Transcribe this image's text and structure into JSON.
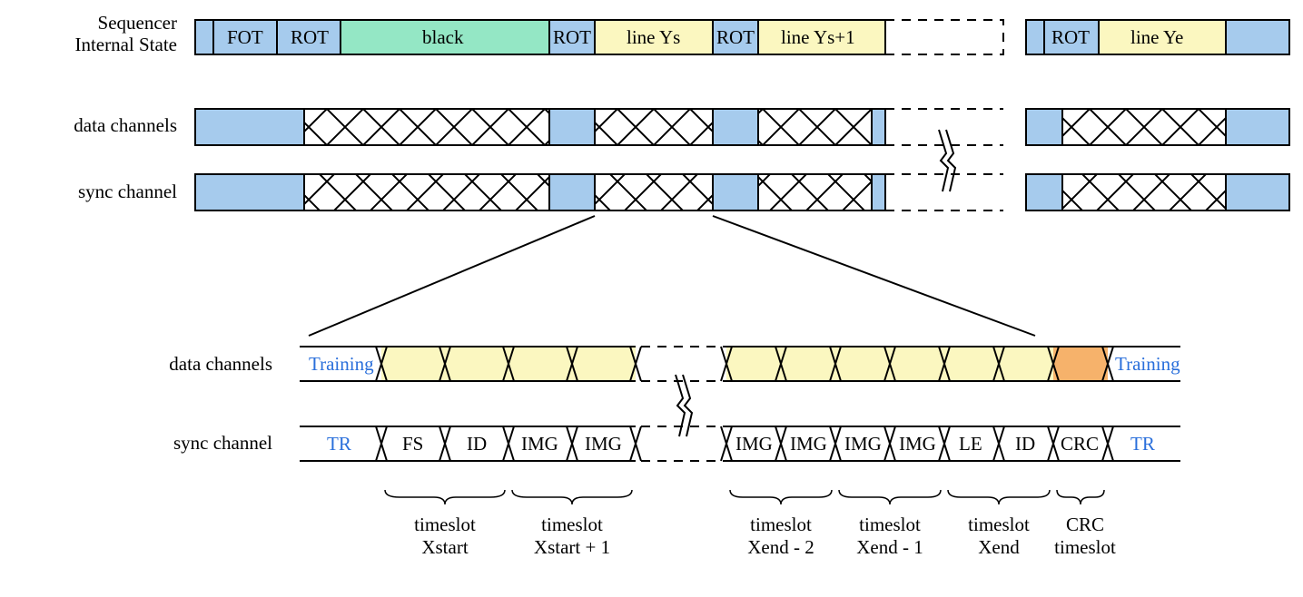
{
  "rows": {
    "seq1": "Sequencer",
    "seq2": "Internal State",
    "data": "data channels",
    "sync": "sync channel"
  },
  "top_states": {
    "fot": "FOT",
    "rot": "ROT",
    "black": "black",
    "lineYs": "line Ys",
    "lineYs1": "line Ys+1",
    "lineYe": "line Ye"
  },
  "detail": {
    "training": "Training",
    "tr": "TR",
    "fs": "FS",
    "id": "ID",
    "img": "IMG",
    "le": "LE",
    "crc": "CRC"
  },
  "timeslots": {
    "xs": "timeslot",
    "xs_": "Xstart",
    "xs1": "timeslot",
    "xs1_": "Xstart + 1",
    "xe2": "timeslot",
    "xe2_": "Xend - 2",
    "xe1": "timeslot",
    "xe1_": "Xend - 1",
    "xe": "timeslot",
    "xe_": "Xend",
    "crc": "CRC",
    "crc_": "timeslot"
  }
}
